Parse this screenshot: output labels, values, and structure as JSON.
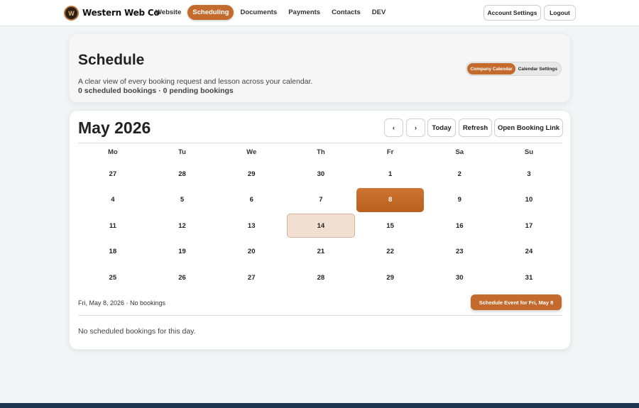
{
  "brand": {
    "name": "Western Web Co",
    "logo_icon": "shield-logo-icon"
  },
  "nav": {
    "items": [
      {
        "label": "Website",
        "active": false
      },
      {
        "label": "Scheduling",
        "active": true
      },
      {
        "label": "Documents",
        "active": false
      },
      {
        "label": "Payments",
        "active": false
      },
      {
        "label": "Contacts",
        "active": false
      },
      {
        "label": "DEV",
        "active": false
      }
    ],
    "account_settings": "Account Settings",
    "logout": "Logout"
  },
  "header": {
    "title": "Schedule",
    "subtitle": "A clear view of every booking request and lesson across your calendar.",
    "counts": "0 scheduled bookings · 0 pending bookings",
    "segments": [
      "Company Calendar",
      "Calendar Settings"
    ]
  },
  "calendar": {
    "month_label": "May 2026",
    "prev_label": "‹",
    "next_label": "›",
    "today_label": "Today",
    "refresh_label": "Refresh",
    "open_link_label": "Open Booking Link",
    "weekdays": [
      "Mo",
      "Tu",
      "We",
      "Th",
      "Fr",
      "Sa",
      "Su"
    ],
    "weeks": [
      [
        "27",
        "28",
        "29",
        "30",
        "1",
        "2",
        "3"
      ],
      [
        "4",
        "5",
        "6",
        "7",
        "8",
        "9",
        "10"
      ],
      [
        "11",
        "12",
        "13",
        "14",
        "15",
        "16",
        "17"
      ],
      [
        "18",
        "19",
        "20",
        "21",
        "22",
        "23",
        "24"
      ],
      [
        "25",
        "26",
        "27",
        "28",
        "29",
        "30",
        "31"
      ]
    ],
    "selected_day": "8",
    "today_day": "14",
    "selected_info": "Fri, May 8, 2026 · No bookings",
    "schedule_button": "Schedule Event for Fri, May 8",
    "empty_message": "No scheduled bookings for this day."
  },
  "colors": {
    "accent": "#c46a2c",
    "today_bg": "#f1e0d2"
  }
}
